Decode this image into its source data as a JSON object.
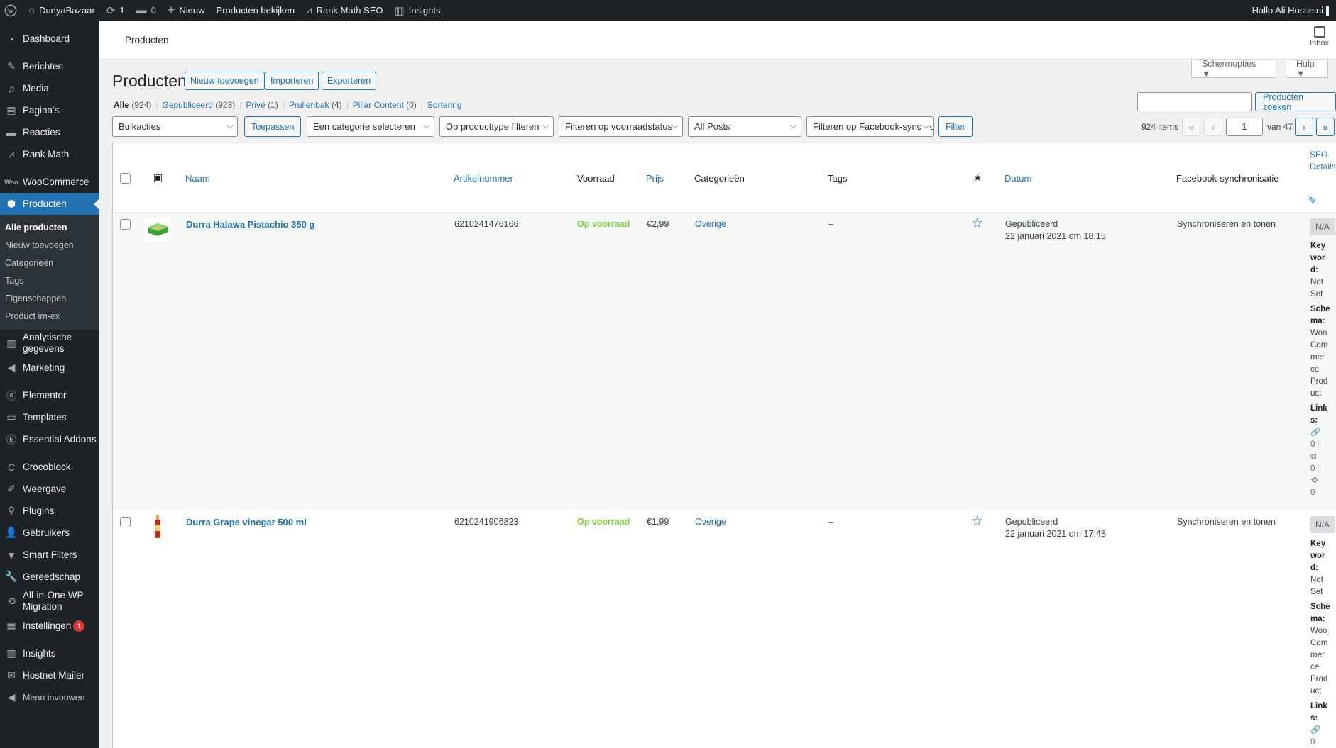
{
  "adminbar": {
    "site_name": "DunyaBazaar",
    "updates_count": "1",
    "comments_count": "0",
    "new_label": "Nieuw",
    "view_products": "Producten bekijken",
    "rank_math": "Rank Math SEO",
    "insights": "Insights",
    "greeting": "Hallo Ali Hosseini"
  },
  "sidebar": {
    "items": [
      {
        "label": "Dashboard",
        "icon": "dashboard-icon"
      },
      {
        "label": "Berichten",
        "icon": "pin-icon"
      },
      {
        "label": "Media",
        "icon": "media-icon"
      },
      {
        "label": "Pagina's",
        "icon": "page-icon"
      },
      {
        "label": "Reacties",
        "icon": "comment-icon"
      },
      {
        "label": "Rank Math",
        "icon": "chart-icon"
      },
      {
        "label": "WooCommerce",
        "icon": "woo-icon"
      },
      {
        "label": "Producten",
        "icon": "box-icon"
      },
      {
        "label": "Analytische gegevens",
        "icon": "bar-chart-icon"
      },
      {
        "label": "Marketing",
        "icon": "megaphone-icon"
      },
      {
        "label": "Elementor",
        "icon": "elementor-icon"
      },
      {
        "label": "Templates",
        "icon": "folder-icon"
      },
      {
        "label": "Essential Addons",
        "icon": "ea-icon"
      },
      {
        "label": "Crocoblock",
        "icon": "croco-icon"
      },
      {
        "label": "Weergave",
        "icon": "brush-icon"
      },
      {
        "label": "Plugins",
        "icon": "plug-icon"
      },
      {
        "label": "Gebruikers",
        "icon": "user-icon"
      },
      {
        "label": "Smart Filters",
        "icon": "filter-icon"
      },
      {
        "label": "Gereedschap",
        "icon": "wrench-icon"
      },
      {
        "label": "All-in-One WP Migration",
        "icon": "migration-icon"
      },
      {
        "label": "Instellingen",
        "icon": "settings-icon",
        "badge": "1"
      },
      {
        "label": "Insights",
        "icon": "insights-icon"
      },
      {
        "label": "Hostnet Mailer",
        "icon": "mail-icon"
      },
      {
        "label": "Menu invouwen",
        "icon": "collapse-icon"
      }
    ],
    "submenu": [
      "Alle producten",
      "Nieuw toevoegen",
      "Categorieën",
      "Tags",
      "Eigenschappen",
      "Product im-ex"
    ]
  },
  "header": {
    "title": "Producten",
    "inbox": "Inbox"
  },
  "screen_options": "Schermopties ▼",
  "help": "Hulp ▼",
  "page": {
    "title": "Producten",
    "add_new": "Nieuw toevoegen",
    "import": "Importeren",
    "export": "Exporteren"
  },
  "views": {
    "all": "Alle",
    "all_count": "(924)",
    "published": "Gepubliceerd",
    "published_count": "(923)",
    "private": "Privé",
    "private_count": "(1)",
    "trash": "Prullenbak",
    "trash_count": "(4)",
    "pillar": "Pillar Content",
    "pillar_count": "(0)",
    "sorting": "Sortering"
  },
  "search": {
    "button": "Producten zoeken",
    "value": ""
  },
  "filters": {
    "bulk": "Bulkacties",
    "apply": "Toepassen",
    "category": "Een categorie selecteren",
    "product_type": "Op producttype filteren",
    "stock_status": "Filteren op voorraadstatus",
    "posts": "All Posts",
    "facebook": "Filteren op Facebook-synchronisatie",
    "filter_btn": "Filter"
  },
  "pagination": {
    "items": "924 items",
    "first": "«",
    "prev": "‹",
    "current": "1",
    "of": "van 47",
    "next": "›",
    "last": "»"
  },
  "table": {
    "columns": {
      "name": "Naam",
      "sku": "Artikelnummer",
      "stock": "Voorraad",
      "price": "Prijs",
      "categories": "Categorieën",
      "tags": "Tags",
      "featured": "★",
      "date": "Datum",
      "facebook": "Facebook-synchronisatie",
      "seo1": "SEO",
      "seo2": "Details"
    },
    "rows": [
      {
        "name": "Durra Halawa Pistachio 350 g",
        "sku": "6210241476166",
        "stock": "Op voorraad",
        "price": "€2,99",
        "category": "Overige",
        "tags": "–",
        "status": "Gepubliceerd",
        "date": "22 januari 2021 om 18:15",
        "facebook": "Synchroniseren en tonen",
        "seo_score": "N/A",
        "seo_lines": [
          "Key",
          "wor",
          "d:",
          "Not",
          "Set"
        ],
        "schema_lines": [
          "Sche",
          "ma:",
          "Woo",
          "Com",
          "mer",
          "ce",
          "Prod",
          "uct"
        ],
        "links_lines": [
          "Link",
          "s:"
        ],
        "links_counts": [
          "0",
          "0",
          "0"
        ]
      },
      {
        "name": "Durra Grape vinegar 500 ml",
        "sku": "6210241906823",
        "stock": "Op voorraad",
        "price": "€1,99",
        "category": "Overige",
        "tags": "–",
        "status": "Gepubliceerd",
        "date": "22 januari 2021 om 17:48",
        "facebook": "Synchroniseren en tonen",
        "seo_score": "N/A",
        "seo_lines": [
          "Key",
          "wor",
          "d:",
          "Not",
          "Set"
        ],
        "schema_lines": [
          "Sche",
          "ma:",
          "Woo",
          "Com",
          "mer",
          "ce",
          "Prod",
          "uct"
        ],
        "links_lines": [
          "Link",
          "s:"
        ],
        "links_counts": [
          "0"
        ]
      }
    ]
  },
  "colors": {
    "accent": "#2271b1",
    "sidebar": "#1d2327",
    "instock": "#7ad03a",
    "badge": "#d63638"
  }
}
